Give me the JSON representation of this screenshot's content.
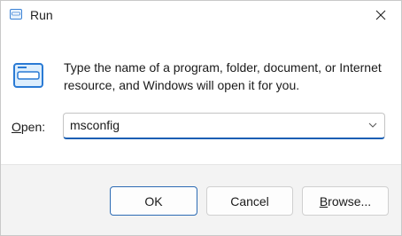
{
  "window": {
    "title": "Run",
    "title_icon": "run-icon",
    "close_icon": "close-icon"
  },
  "content": {
    "icon": "run-icon",
    "description": "Type the name of a program, folder, document, or Internet resource, and Windows will open it for you.",
    "open_label_mnemonic": "O",
    "open_label_rest": "pen:",
    "open_value": "msconfig",
    "dropdown_icon": "chevron-down-icon"
  },
  "buttons": {
    "ok": "OK",
    "cancel": "Cancel",
    "browse_mnemonic": "B",
    "browse_rest": "rowse..."
  },
  "colors": {
    "accent": "#1a5fb4",
    "footer_bg": "#f3f3f3",
    "icon_blue": "#2a7ad4"
  }
}
